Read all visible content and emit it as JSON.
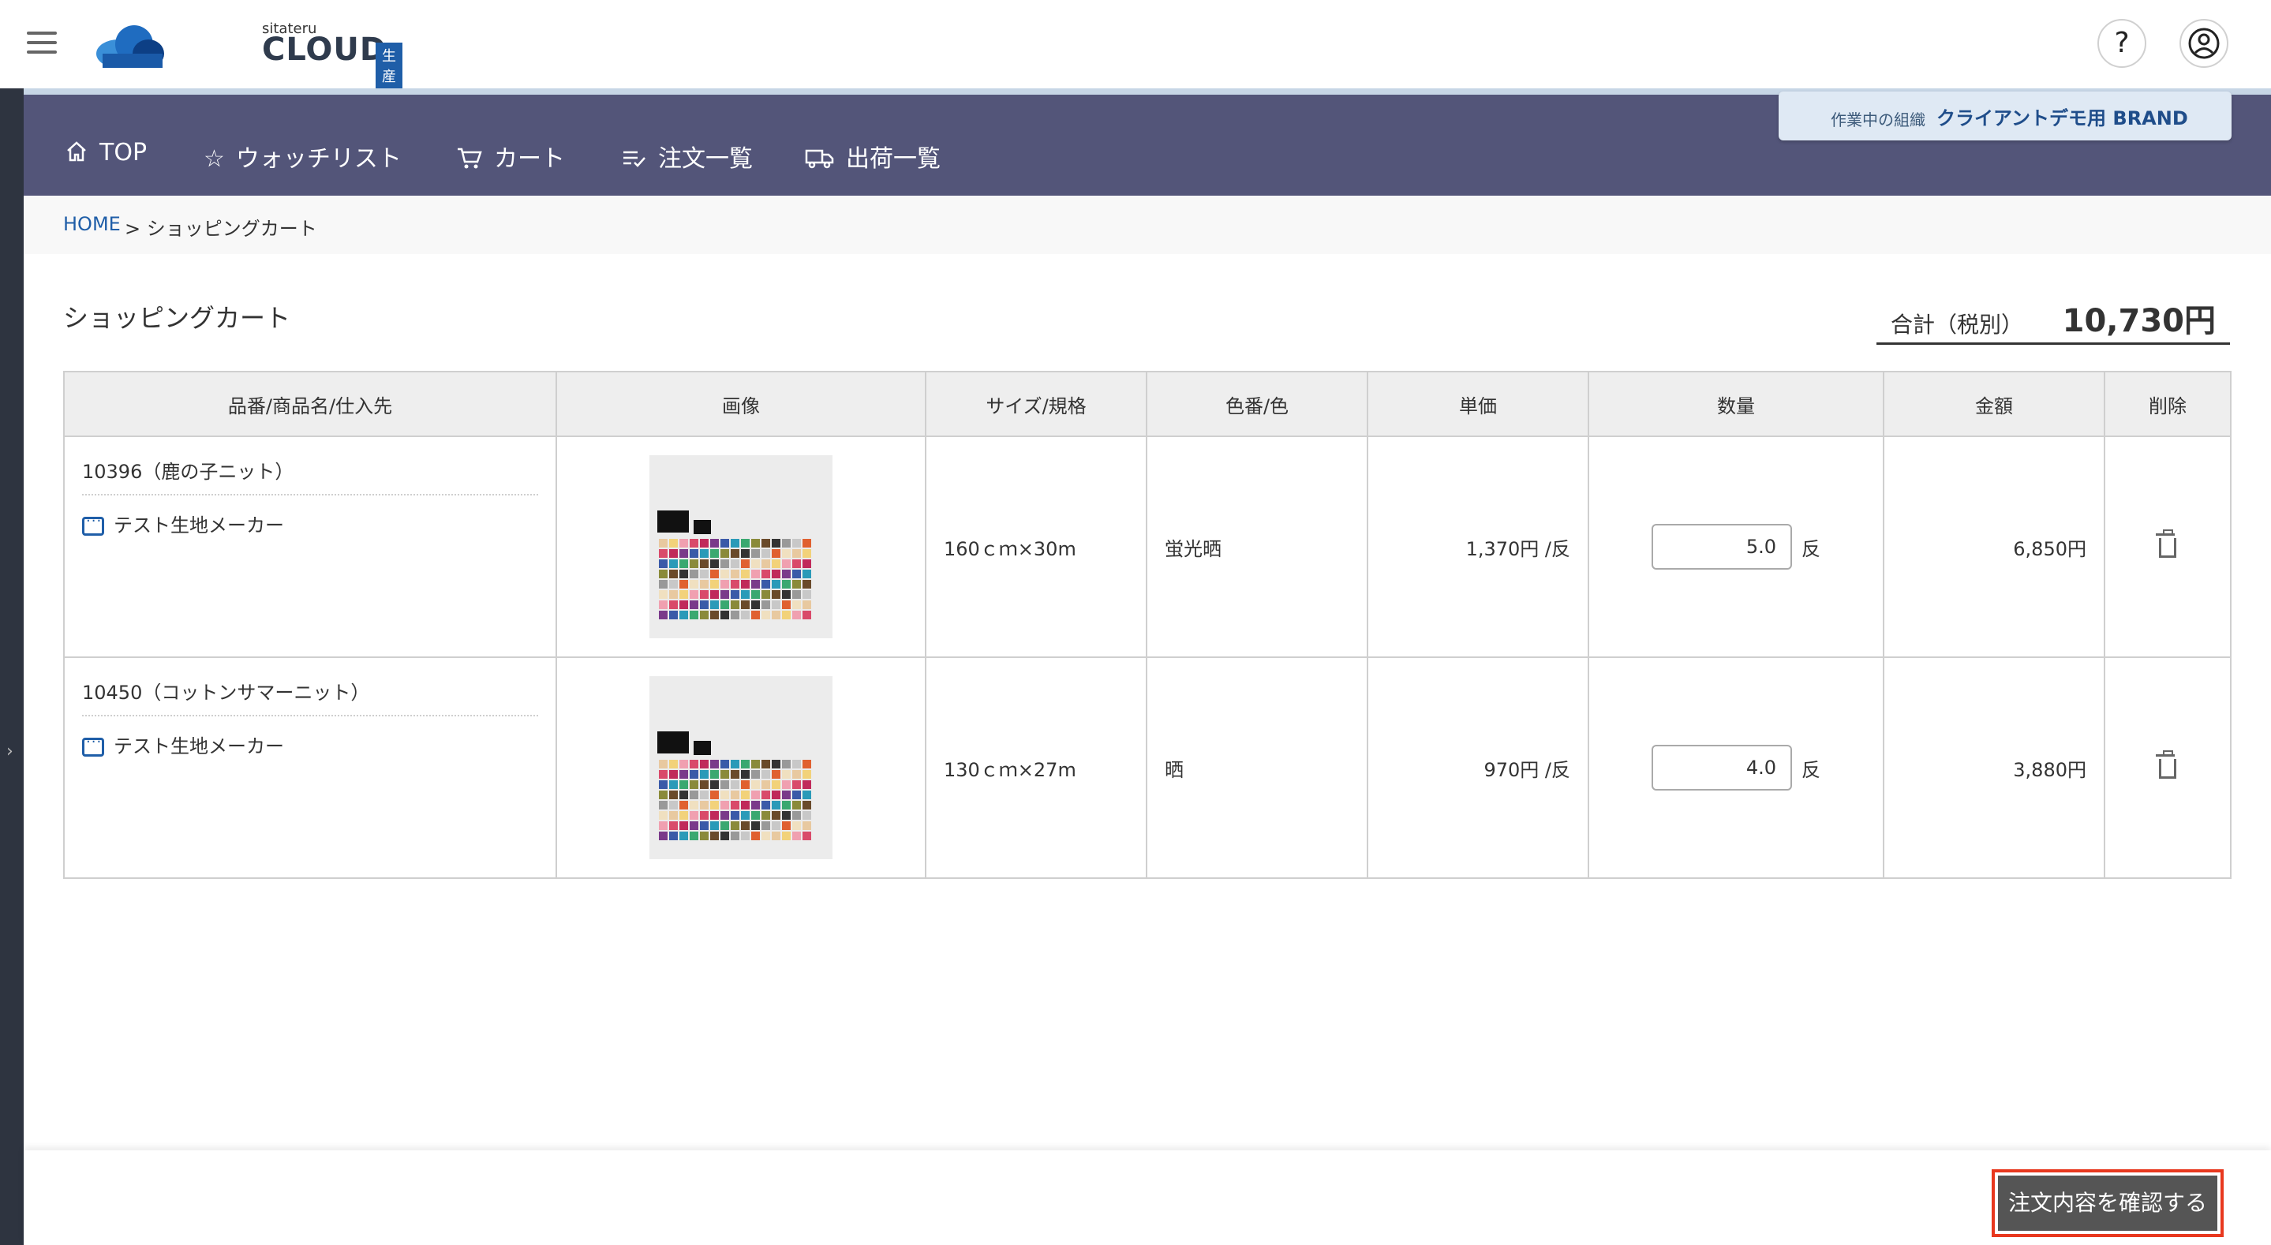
{
  "header": {
    "logo_small": "sitateru",
    "logo_big": "CLOUD",
    "logo_badge": "生産支援",
    "help_label": "?"
  },
  "nav": {
    "items": [
      {
        "label": "TOP",
        "icon": "home-icon"
      },
      {
        "label": "ウォッチリスト",
        "icon": "star-icon"
      },
      {
        "label": "カート",
        "icon": "cart-icon"
      },
      {
        "label": "注文一覧",
        "icon": "list-check-icon"
      },
      {
        "label": "出荷一覧",
        "icon": "truck-icon"
      }
    ],
    "org_label": "作業中の組織",
    "org_name": "クライアントデモ用 BRAND"
  },
  "breadcrumb": {
    "home": "HOME",
    "current": "> ショッピングカート"
  },
  "page": {
    "title": "ショッピングカート",
    "total_label": "合計（税別）",
    "total_value": "10,730円"
  },
  "table": {
    "headers": [
      "品番/商品名/仕入先",
      "画像",
      "サイズ/規格",
      "色番/色",
      "単価",
      "数量",
      "金額",
      "削除"
    ],
    "rows": [
      {
        "name": "10396（鹿の子ニット）",
        "supplier": "テスト生地メーカー",
        "size": "160ｃｍ×30m",
        "color": "蛍光晒",
        "unit_price": "1,370円 /反",
        "qty": "5.0",
        "qty_unit": "反",
        "amount": "6,850円"
      },
      {
        "name": "10450（コットンサマーニット）",
        "supplier": "テスト生地メーカー",
        "size": "130ｃｍ×27m",
        "color": "晒",
        "unit_price": "970円 /反",
        "qty": "4.0",
        "qty_unit": "反",
        "amount": "3,880円"
      }
    ]
  },
  "footer": {
    "confirm_label": "注文内容を確認する"
  },
  "colors": {
    "nav_bg": "#535579",
    "accent": "#1f5ea8",
    "highlight_border": "#e8381e"
  }
}
